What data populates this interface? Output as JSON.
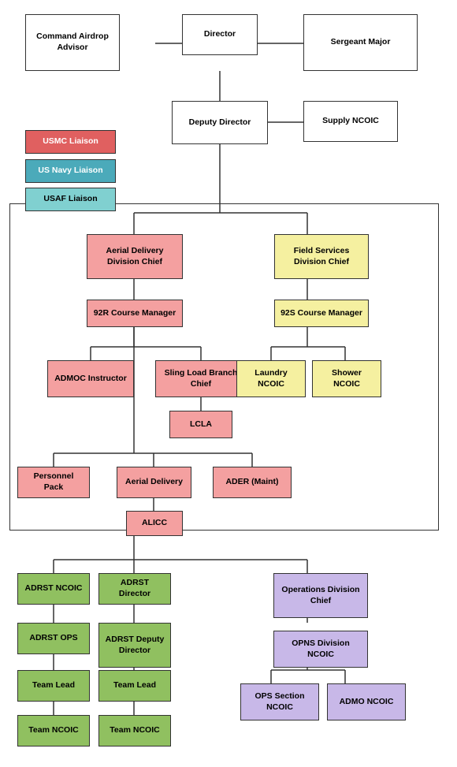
{
  "boxes": {
    "director": {
      "label": "Director"
    },
    "sergeant_major": {
      "label": "Sergeant Major"
    },
    "command_airdrop": {
      "label": "Command Airdrop Advisor"
    },
    "deputy_director": {
      "label": "Deputy Director"
    },
    "supply_ncoic": {
      "label": "Supply NCOIC"
    },
    "usmc_liaison": {
      "label": "USMC Liaison"
    },
    "us_navy_liaison": {
      "label": "US Navy Liaison"
    },
    "usaf_liaison": {
      "label": "USAF Liaison"
    },
    "aerial_delivery_chief": {
      "label": "Aerial Delivery Division Chief"
    },
    "field_services_chief": {
      "label": "Field Services Division Chief"
    },
    "92r_course_manager": {
      "label": "92R Course Manager"
    },
    "92s_course_manager": {
      "label": "92S Course Manager"
    },
    "admoc_instructor": {
      "label": "ADMOC Instructor"
    },
    "sling_load_branch": {
      "label": "Sling Load Branch Chief"
    },
    "lcla": {
      "label": "LCLA"
    },
    "laundry_ncoic": {
      "label": "Laundry NCOIC"
    },
    "shower_ncoic": {
      "label": "Shower NCOIC"
    },
    "personnel_pack": {
      "label": "Personnel Pack"
    },
    "aerial_delivery": {
      "label": "Aerial Delivery"
    },
    "ader_maint": {
      "label": "ADER (Maint)"
    },
    "alicc": {
      "label": "ALICC"
    },
    "adrst_ncoic": {
      "label": "ADRST NCOIC"
    },
    "adrst_director": {
      "label": "ADRST Director"
    },
    "adrst_ops": {
      "label": "ADRST OPS"
    },
    "adrst_deputy": {
      "label": "ADRST Deputy Director"
    },
    "team_lead_1": {
      "label": "Team Lead"
    },
    "team_lead_2": {
      "label": "Team Lead"
    },
    "team_ncoic_1": {
      "label": "Team NCOIC"
    },
    "team_ncoic_2": {
      "label": "Team NCOIC"
    },
    "operations_chief": {
      "label": "Operations Division Chief"
    },
    "opns_ncoic": {
      "label": "OPNS Division NCOIC"
    },
    "ops_section_ncoic": {
      "label": "OPS Section NCOIC"
    },
    "admo_ncoic": {
      "label": "ADMO NCOIC"
    }
  }
}
